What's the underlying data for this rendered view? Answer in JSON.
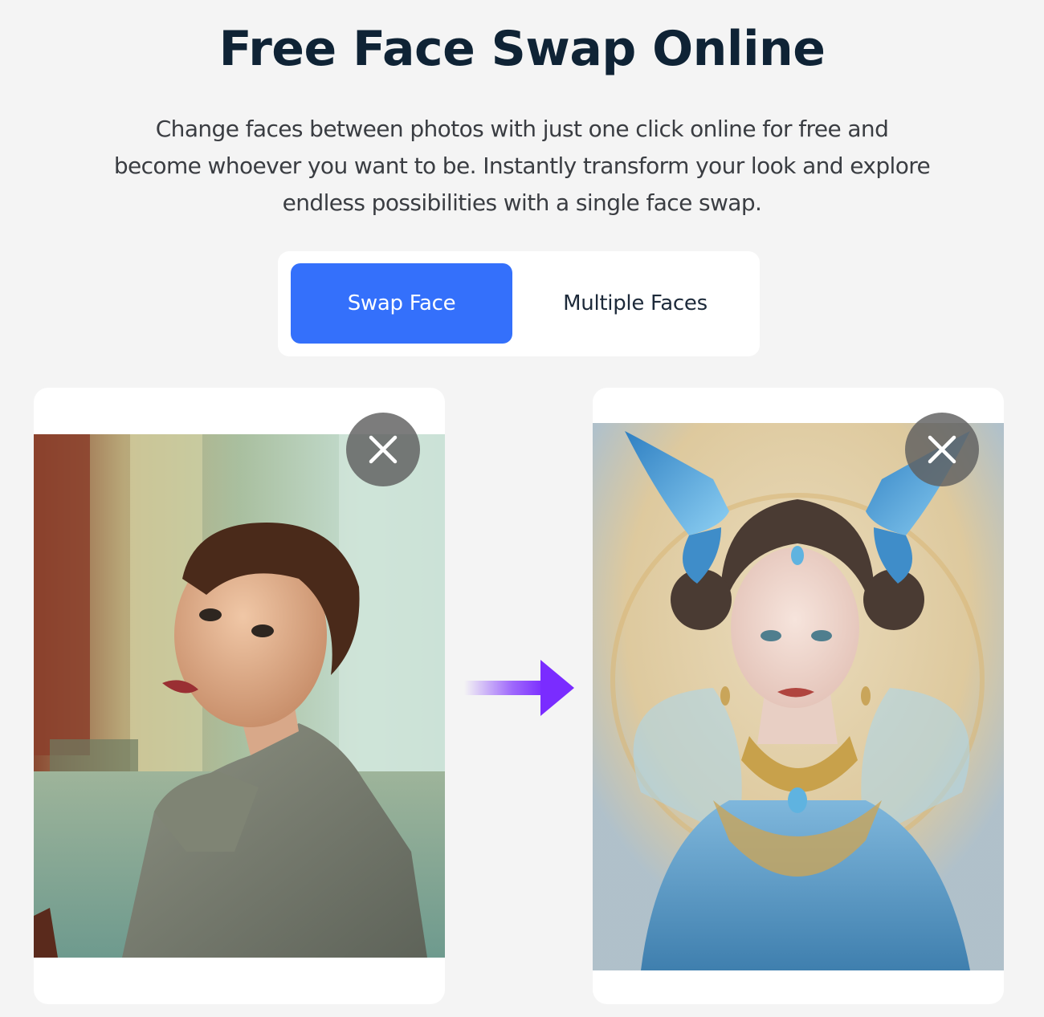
{
  "header": {
    "title": "Free Face Swap Online",
    "subtitle": "Change faces between photos with just one click online for free and become whoever you want to be. Instantly transform your look and explore endless possibilities with a single face swap."
  },
  "tabs": [
    {
      "label": "Swap Face",
      "active": true
    },
    {
      "label": "Multiple Faces",
      "active": false
    }
  ],
  "source_image": {
    "close_icon": "close-icon"
  },
  "target_image": {
    "close_icon": "close-icon"
  },
  "arrow_icon": "arrow-right-icon",
  "colors": {
    "accent": "#3470fb",
    "background": "#f4f4f4",
    "arrow_gradient_end": "#7a2cff"
  }
}
